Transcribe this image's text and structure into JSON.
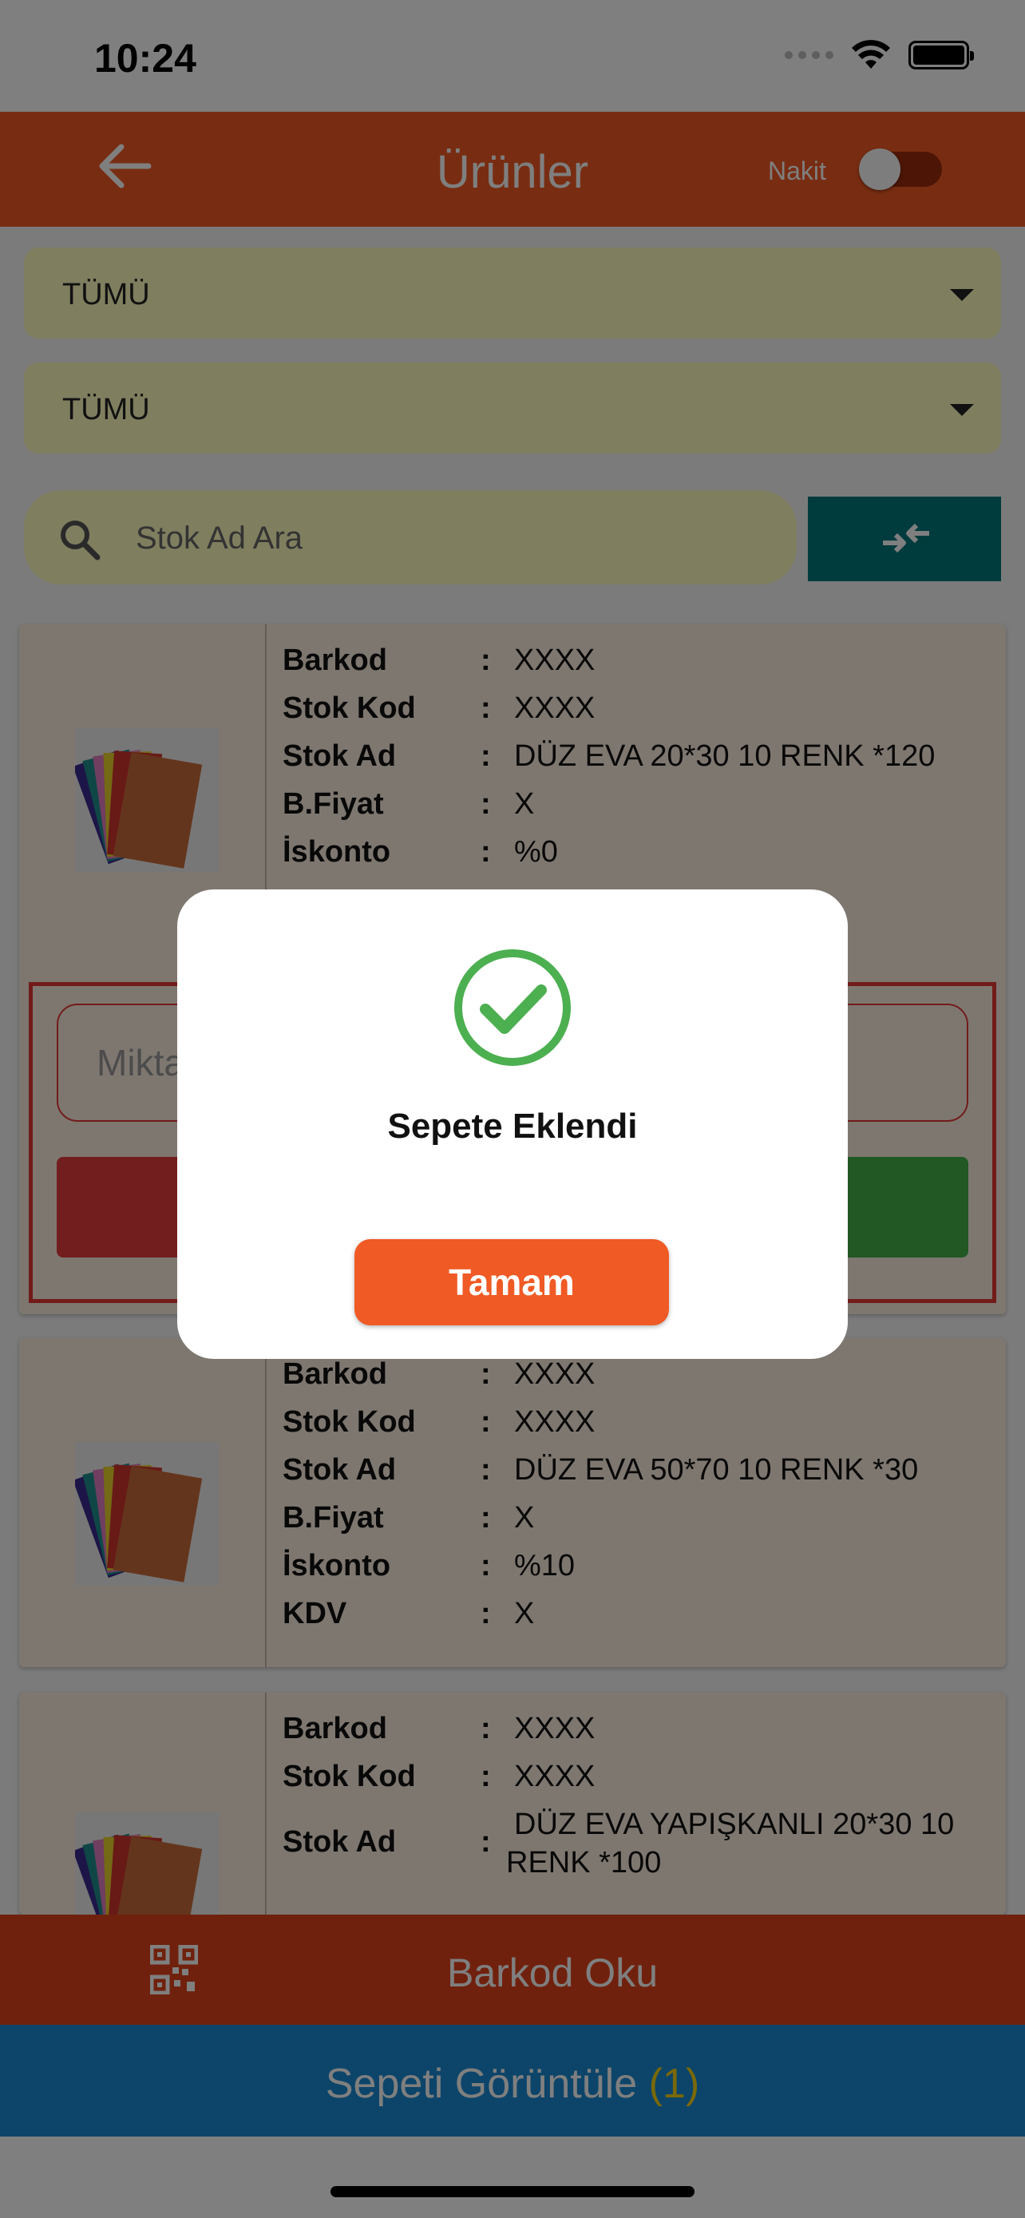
{
  "status_bar": {
    "time": "10:24"
  },
  "header": {
    "title": "Ürünler",
    "toggle_label": "Nakit",
    "toggle_on": false
  },
  "filters": {
    "dropdown1": "TÜMÜ",
    "dropdown2": "TÜMÜ"
  },
  "search": {
    "placeholder": "Stok Ad Ara"
  },
  "field_labels": {
    "barkod": "Barkod",
    "stok_kod": "Stok Kod",
    "stok_ad": "Stok Ad",
    "b_fiyat": "B.Fiyat",
    "iskonto": "İskonto",
    "kdv": "KDV",
    "colon": ":"
  },
  "products": [
    {
      "barkod": "XXXX",
      "stok_kod": "XXXX",
      "stok_ad": "DÜZ EVA 20*30 10 RENK *120",
      "b_fiyat": "X",
      "iskonto": "%0",
      "quantity_placeholder": "Miktar"
    },
    {
      "barkod": "XXXX",
      "stok_kod": "XXXX",
      "stok_ad": "DÜZ EVA 50*70 10 RENK *30",
      "b_fiyat": "X",
      "iskonto": "%10",
      "kdv": "X"
    },
    {
      "barkod": "XXXX",
      "stok_kod": "XXXX",
      "stok_ad_line1": "DÜZ EVA YAPIŞKANLI 20*30 10",
      "stok_ad_line2": "RENK *100"
    }
  ],
  "bottom": {
    "barcode_label": "Barkod Oku",
    "cart_label": "Sepeti Görüntüle",
    "cart_count": "(1)"
  },
  "dialog": {
    "message": "Sepete Eklendi",
    "ok_label": "Tamam",
    "icon": "check-circle-icon",
    "icon_color": "#4caf50"
  },
  "colors": {
    "primary": "#f05a24",
    "cart_bar": "#1a8ad4",
    "filter_bg": "#fffcbe",
    "swap_button": "#00767d",
    "card_bg": "#fdeee1"
  }
}
